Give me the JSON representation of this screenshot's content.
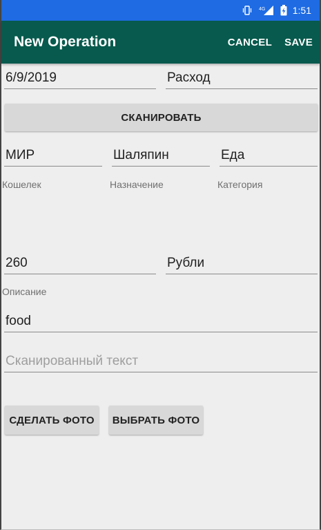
{
  "status_bar": {
    "time": "1:51",
    "network": "4G",
    "icons": [
      "vibrate-icon",
      "signal-icon",
      "battery-icon"
    ]
  },
  "app_bar": {
    "title": "New Operation",
    "cancel_label": "CANCEL",
    "save_label": "SAVE"
  },
  "form": {
    "date": "6/9/2019",
    "type": "Расход",
    "scan_label": "СКАНИРОВАТЬ",
    "wallet_value": "МИР",
    "purpose_value": "Шаляпин",
    "category_value": "Еда",
    "wallet_label": "Кошелек",
    "purpose_label": "Назначение",
    "category_label": "Категория",
    "amount": "260",
    "currency": "Рубли",
    "description_label": "Описание",
    "description_value": "food",
    "scanned_text_placeholder": "Сканированный текст",
    "take_photo_label": "СДЕЛАТЬ ФОТО",
    "choose_photo_label": "ВЫБРАТЬ ФОТО"
  },
  "colors": {
    "status_bar": "#1e6be3",
    "app_bar": "#075a4d",
    "background": "#eeeeee"
  }
}
